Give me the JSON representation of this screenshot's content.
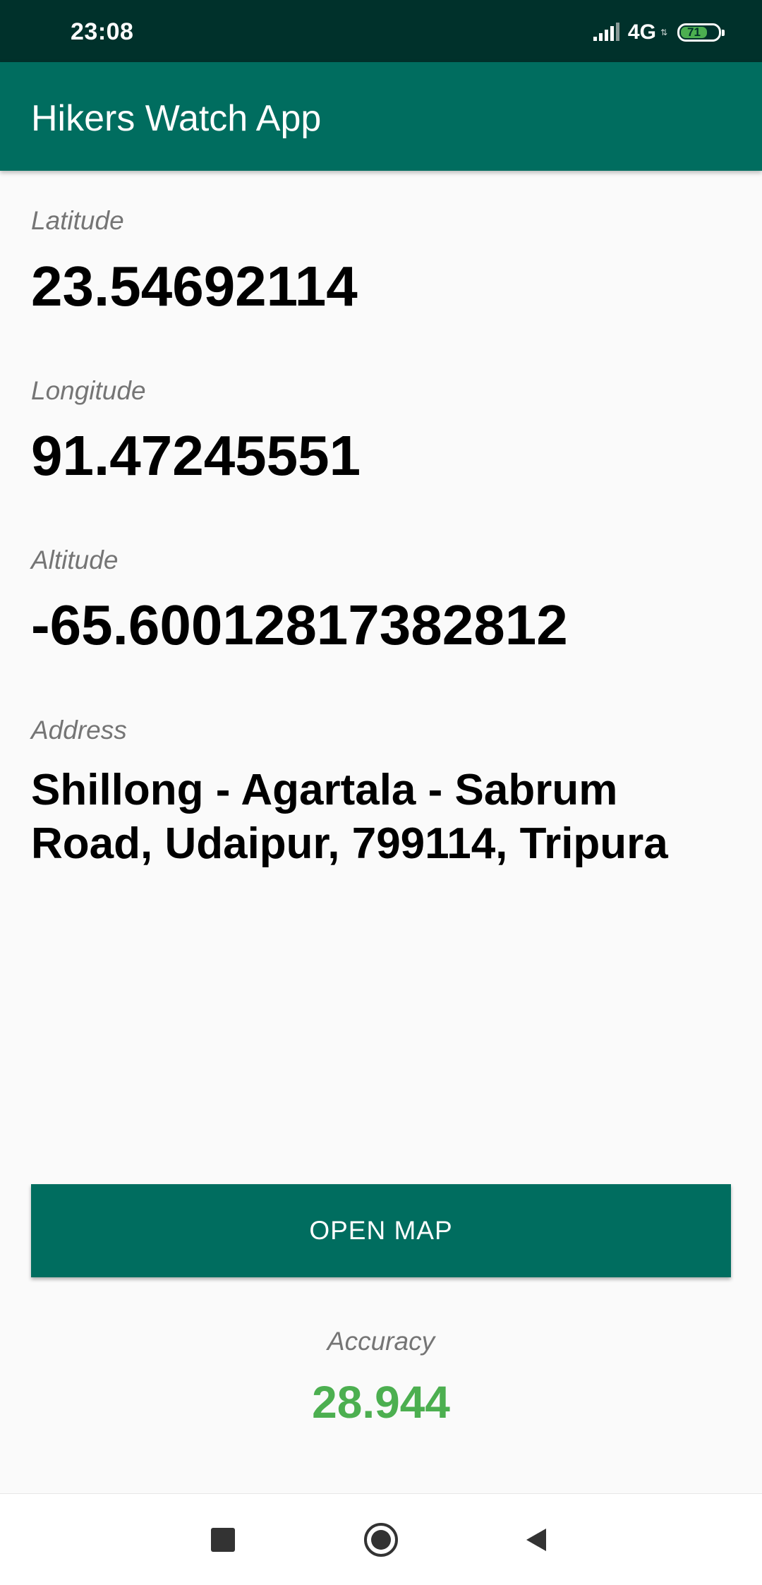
{
  "status_bar": {
    "time": "23:08",
    "network": "4G",
    "battery_level": "71",
    "battery_fraction": 0.71,
    "icons": [
      "signal-icon",
      "battery-icon"
    ]
  },
  "app_bar": {
    "title": "Hikers Watch App"
  },
  "location": {
    "latitude_label": "Latitude",
    "latitude_value": "23.54692114",
    "longitude_label": "Longitude",
    "longitude_value": "91.47245551",
    "altitude_label": "Altitude",
    "altitude_value": "-65.60012817382812",
    "address_label": "Address",
    "address_value": "Shillong - Agartala - Sabrum Road, Udaipur, 799114, Tripura"
  },
  "actions": {
    "open_map_label": "OPEN MAP"
  },
  "accuracy": {
    "label": "Accuracy",
    "value": "28.944"
  },
  "navigation": {
    "icons": [
      "recent-apps-icon",
      "home-icon",
      "back-icon"
    ]
  },
  "colors": {
    "status_bar": "#00312b",
    "primary": "#006d5f",
    "accuracy_green": "#4caf50",
    "label_gray": "#757575"
  }
}
